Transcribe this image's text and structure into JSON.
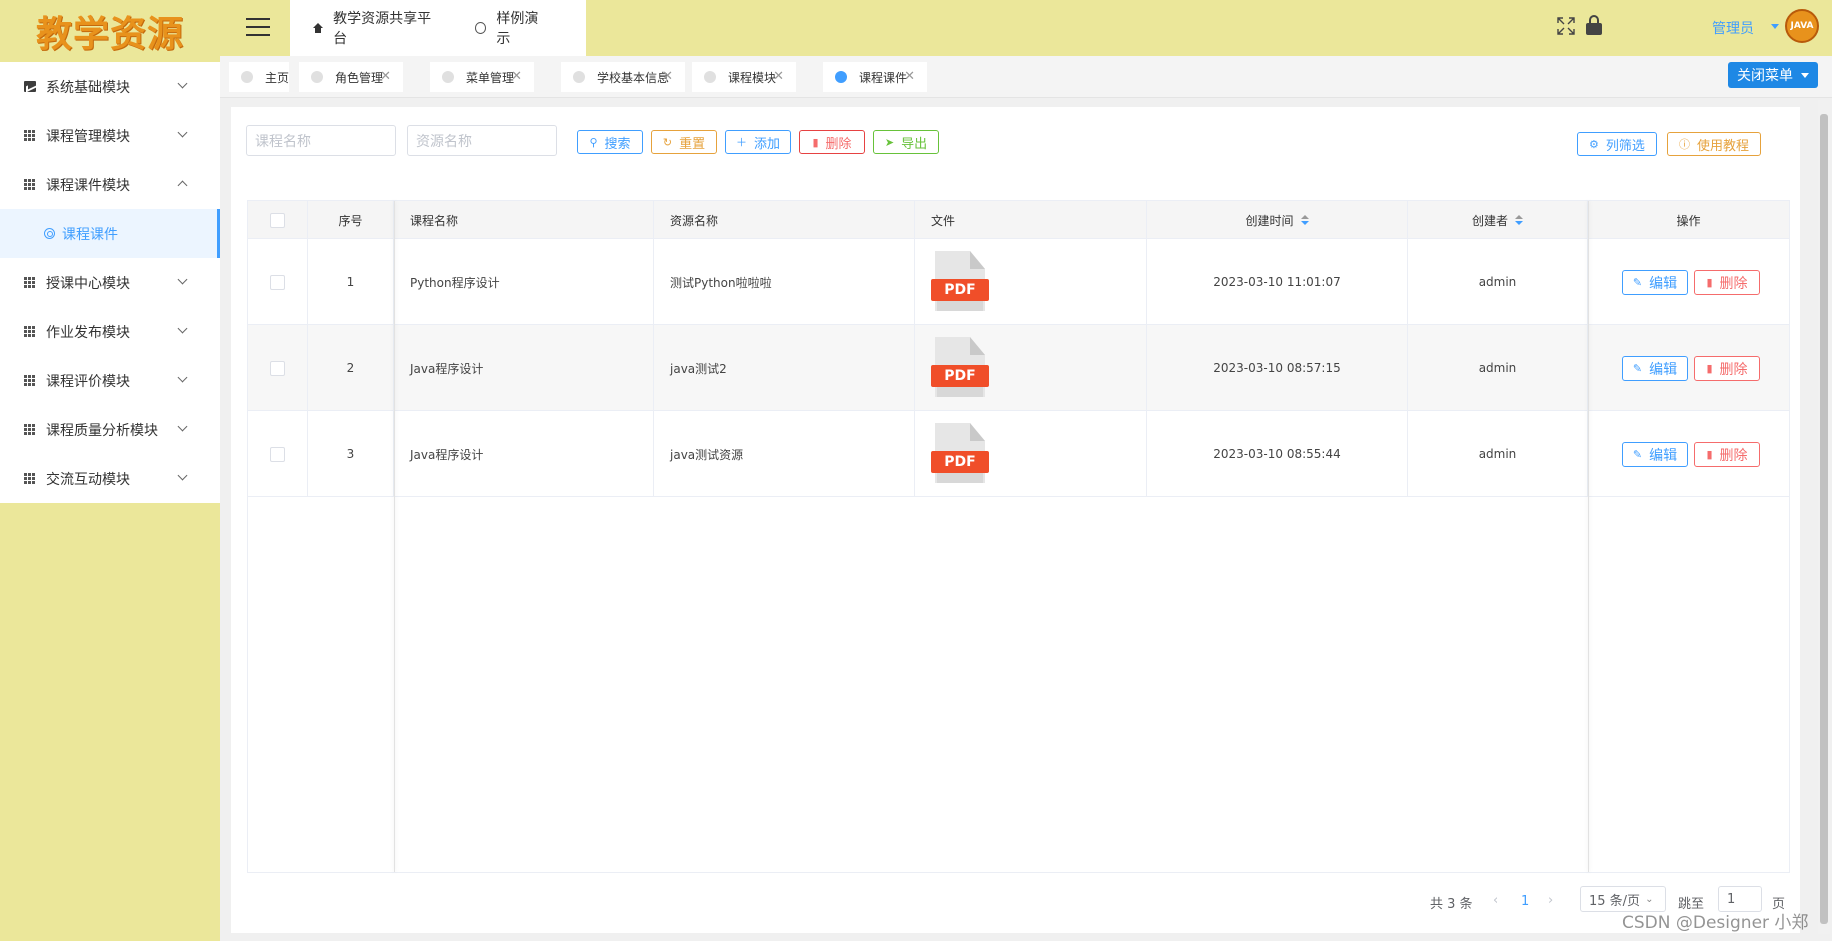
{
  "logo": "教学资源",
  "sidebar": {
    "items": [
      {
        "label": "系统基础模块",
        "icon": "chart-icon",
        "expanded": false
      },
      {
        "label": "课程管理模块",
        "icon": "grid-icon",
        "expanded": false
      },
      {
        "label": "课程课件模块",
        "icon": "grid-icon",
        "expanded": true
      },
      {
        "label": "授课中心模块",
        "icon": "grid-icon",
        "expanded": false
      },
      {
        "label": "作业发布模块",
        "icon": "grid-icon",
        "expanded": false
      },
      {
        "label": "课程评价模块",
        "icon": "grid-icon",
        "expanded": false
      },
      {
        "label": "课程质量分析模块",
        "icon": "grid-icon",
        "expanded": false
      },
      {
        "label": "交流互动模块",
        "icon": "grid-icon",
        "expanded": false
      }
    ],
    "active_sub": "课程课件"
  },
  "header": {
    "tabs": [
      {
        "label": "教学资源共享平台",
        "icon": "home-icon"
      },
      {
        "label": "样例演示",
        "icon": "bulb-icon"
      }
    ],
    "admin": "管理员",
    "avatar_text": "JAVA"
  },
  "tagbar": {
    "tags": [
      {
        "label": "主页",
        "closable": false,
        "active": false
      },
      {
        "label": "角色管理",
        "closable": true,
        "active": false
      },
      {
        "label": "菜单管理",
        "closable": true,
        "active": false
      },
      {
        "label": "学校基本信息",
        "closable": true,
        "active": false
      },
      {
        "label": "课程模块",
        "closable": true,
        "active": false
      },
      {
        "label": "课程课件",
        "closable": true,
        "active": true
      }
    ],
    "close_menu": "关闭菜单",
    "close_glyph": "✕"
  },
  "toolbar": {
    "course_placeholder": "课程名称",
    "resource_placeholder": "资源名称",
    "search": "搜索",
    "reset": "重置",
    "add": "添加",
    "delete": "删除",
    "export": "导出",
    "column_filter": "列筛选",
    "tutorial": "使用教程"
  },
  "table": {
    "headers": {
      "index": "序号",
      "course": "课程名称",
      "resource": "资源名称",
      "file": "文件",
      "created": "创建时间",
      "creator": "创建者",
      "actions": "操作"
    },
    "rows": [
      {
        "index": "1",
        "course": "Python程序设计",
        "resource": "测试Python啦啦啦",
        "file": "PDF",
        "created": "2023-03-10 11:01:07",
        "creator": "admin"
      },
      {
        "index": "2",
        "course": "Java程序设计",
        "resource": "java测试2",
        "file": "PDF",
        "created": "2023-03-10 08:57:15",
        "creator": "admin"
      },
      {
        "index": "3",
        "course": "Java程序设计",
        "resource": "java测试资源",
        "file": "PDF",
        "created": "2023-03-10 08:55:44",
        "creator": "admin"
      }
    ],
    "edit": "编辑",
    "delete": "删除"
  },
  "pagination": {
    "total": "共 3 条",
    "current": "1",
    "page_size": "15 条/页",
    "jump_label": "跳至",
    "jump_value": "1",
    "page_unit": "页"
  },
  "watermark": "CSDN @Designer 小郑"
}
